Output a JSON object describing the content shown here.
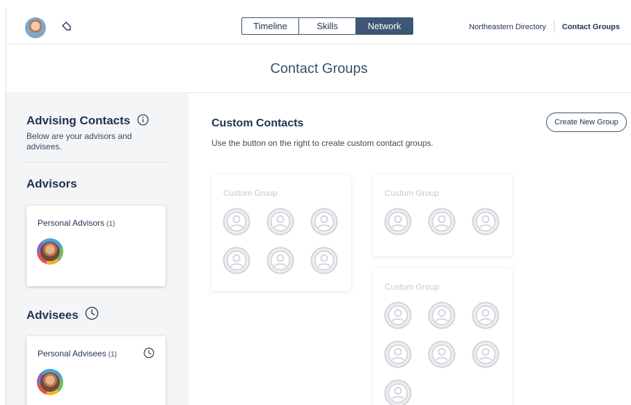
{
  "nav": {
    "tabs": [
      {
        "label": "Timeline",
        "active": false
      },
      {
        "label": "Skills",
        "active": false
      },
      {
        "label": "Network",
        "active": true
      }
    ],
    "links": [
      {
        "label": "Northeastern Directory"
      },
      {
        "label": "Contact Groups"
      }
    ]
  },
  "page": {
    "title": "Contact Groups"
  },
  "sidebar": {
    "heading": "Advising Contacts",
    "description": "Below are your advisors and advisees.",
    "advisors": {
      "heading": "Advisors",
      "card_label": "Personal Advisors",
      "count": "(1)"
    },
    "advisees": {
      "heading": "Advisees",
      "card_label": "Personal Advisees",
      "count": "(1)"
    }
  },
  "main": {
    "heading": "Custom Contacts",
    "description": "Use the button on the right to create custom contact groups.",
    "create_button": "Create New Group",
    "groups": [
      {
        "label": "Custom Group",
        "slots": 6
      },
      {
        "label": "Custom Group",
        "slots": 3
      },
      {
        "label": "Custom Group",
        "slots": 7
      }
    ]
  },
  "colors": {
    "accent": "#3d5775",
    "text": "#1e3250",
    "sidebar_bg": "#f4f5f7",
    "placeholder": "#c4c9cf"
  }
}
